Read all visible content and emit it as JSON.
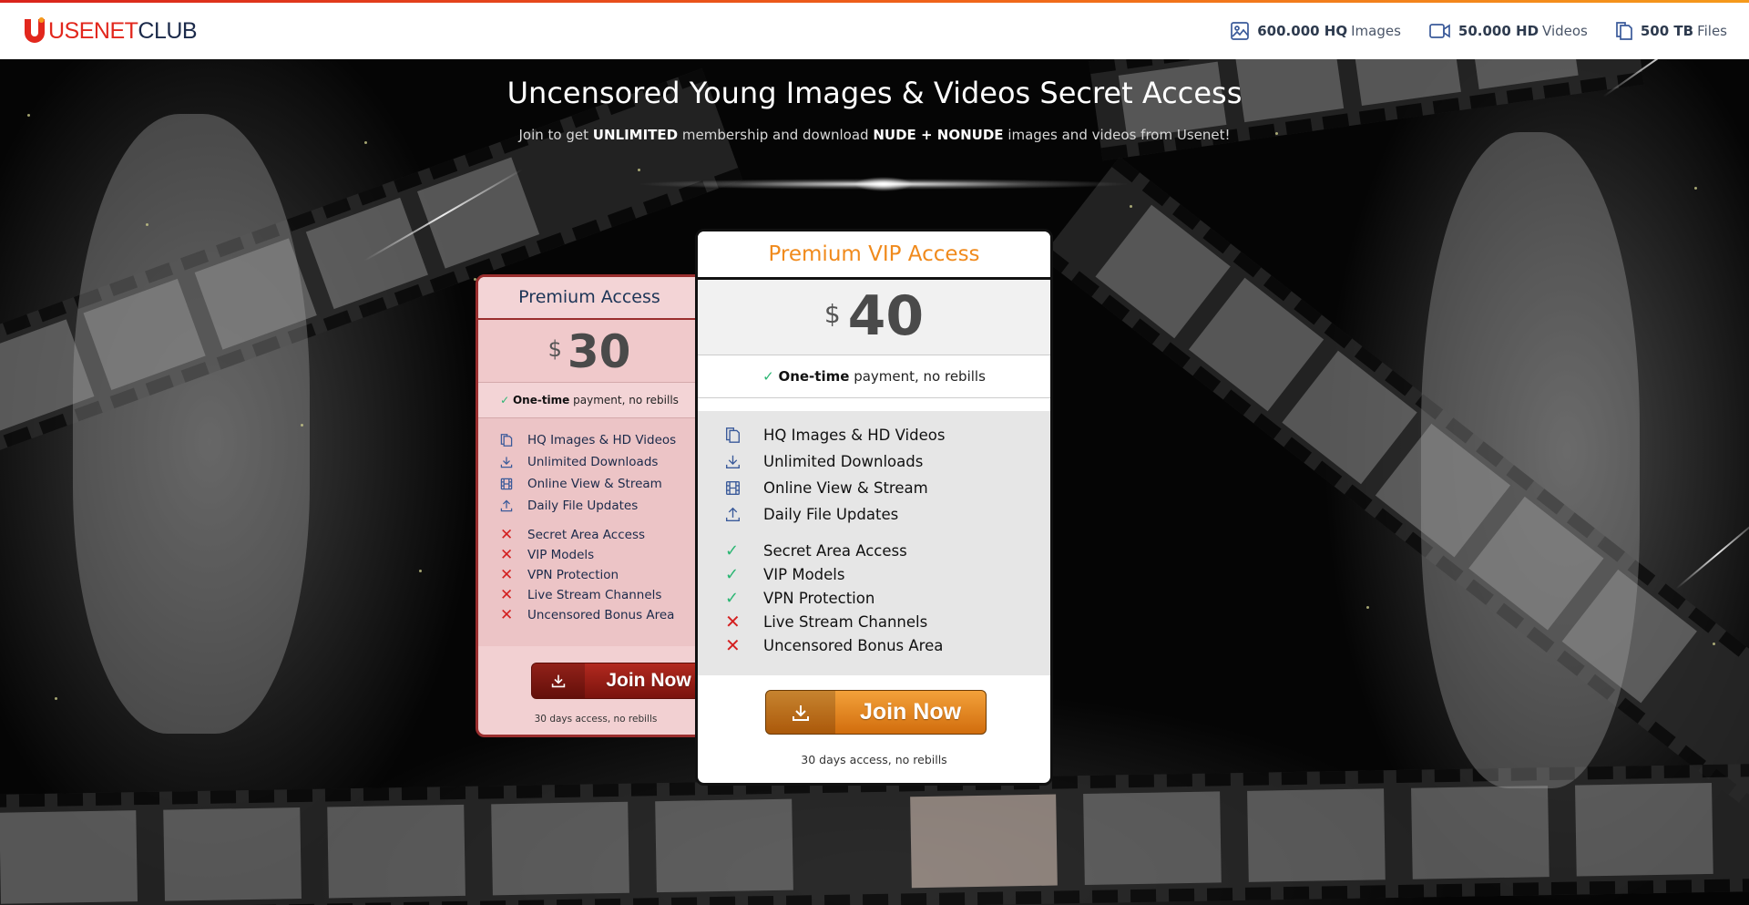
{
  "header": {
    "logo": {
      "part1": "USENET",
      "part2": "CLUB"
    },
    "stats": [
      {
        "icon": "image-icon",
        "value": "600.000 HQ",
        "label": "Images"
      },
      {
        "icon": "video-camera-icon",
        "value": "50.000 HD",
        "label": "Videos"
      },
      {
        "icon": "files-icon",
        "value": "500 TB",
        "label": "Files"
      }
    ]
  },
  "hero": {
    "title": "Uncensored Young Images & Videos Secret Access",
    "sub_prefix": "Join to get",
    "sub_bold1": "UNLIMITED",
    "sub_middle": "membership and download",
    "sub_bold2": "NUDE + NONUDE",
    "sub_suffix": "images and videos from Usenet!"
  },
  "plans": {
    "basic": {
      "name": "Premium Access",
      "currency": "$",
      "price": "30",
      "payment_bold": "One-time",
      "payment_rest": "payment, no rebills",
      "features": [
        {
          "icon": "files-icon",
          "label": "HQ Images & HD Videos"
        },
        {
          "icon": "download-icon",
          "label": "Unlimited Downloads"
        },
        {
          "icon": "film-icon",
          "label": "Online View & Stream"
        },
        {
          "icon": "upload-icon",
          "label": "Daily File Updates"
        }
      ],
      "extras": [
        {
          "included": false,
          "label": "Secret Area Access"
        },
        {
          "included": false,
          "label": "VIP Models"
        },
        {
          "included": false,
          "label": "VPN Protection"
        },
        {
          "included": false,
          "label": "Live Stream Channels"
        },
        {
          "included": false,
          "label": "Uncensored Bonus Area"
        }
      ],
      "button": "Join Now",
      "note": "30 days access, no rebills"
    },
    "vip": {
      "name": "Premium VIP Access",
      "currency": "$",
      "price": "40",
      "payment_bold": "One-time",
      "payment_rest": "payment, no rebills",
      "features": [
        {
          "icon": "files-icon",
          "label": "HQ Images & HD Videos"
        },
        {
          "icon": "download-icon",
          "label": "Unlimited Downloads"
        },
        {
          "icon": "film-icon",
          "label": "Online View & Stream"
        },
        {
          "icon": "upload-icon",
          "label": "Daily File Updates"
        }
      ],
      "extras": [
        {
          "included": true,
          "label": "Secret Area Access"
        },
        {
          "included": true,
          "label": "VIP Models"
        },
        {
          "included": true,
          "label": "VPN Protection"
        },
        {
          "included": false,
          "label": "Live Stream Channels"
        },
        {
          "included": false,
          "label": "Uncensored Bonus Area"
        }
      ],
      "button": "Join Now",
      "note": "30 days access, no rebills"
    }
  },
  "colors": {
    "accent_orange": "#f08a1c",
    "brand_red": "#e2271d",
    "check_green": "#2bb673",
    "cross_red": "#d42020",
    "icon_blue": "#3a5a9a"
  }
}
